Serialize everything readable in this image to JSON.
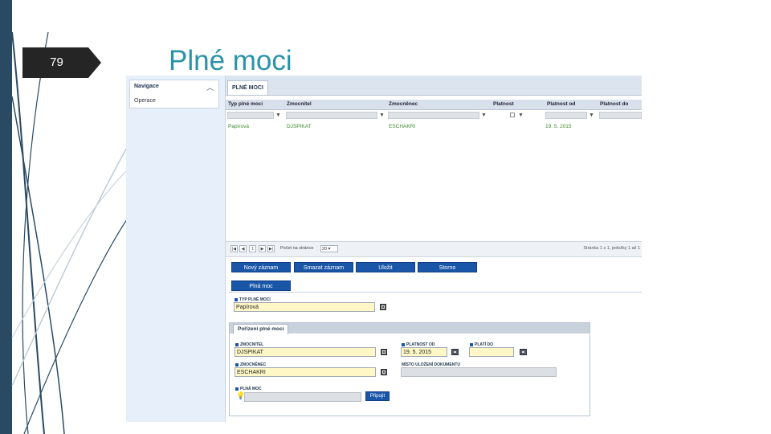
{
  "slide": {
    "number": "79",
    "title": "Plné moci"
  },
  "nav": {
    "header": "Navigace",
    "items": [
      "Operace"
    ]
  },
  "tab": {
    "label": "PLNÉ MOCI"
  },
  "grid": {
    "columns": [
      "Typ plné moci",
      "Zmocnitel",
      "Zmocněnec",
      "Platnost",
      "Platnost od",
      "Platnost do"
    ],
    "rows": [
      [
        "Papírová",
        "DJSPIKAT",
        "ESCHAKRI",
        "",
        "19. 5. 2015",
        ""
      ]
    ]
  },
  "pager": {
    "page": "1",
    "label": "Počet na stránce",
    "page_size": "20",
    "info": "Stránka 1 z 1, položky 1 až 1"
  },
  "actions": {
    "new": "Nový záznam",
    "delete": "Smazat záznam",
    "save": "Uložit",
    "cancel": "Storno"
  },
  "section": {
    "label": "Plná moc"
  },
  "form": {
    "type_label": "TYP PLNÉ MOCI",
    "type_value": "Papírová",
    "panel_tab": "Pořízení plné moci",
    "principal_label": "ZMOCNITEL",
    "principal_value": "DJSPIKAT",
    "agent_label": "ZMOCNĚNEC",
    "agent_value": "ESCHAKRI",
    "valid_from_label": "PLATNOST OD",
    "valid_from_value": "19. 5. 2015",
    "valid_to_label": "PLATÍ DO",
    "valid_to_value": "",
    "storage_label": "MÍSTO ULOŽENÍ DOKUMENTU",
    "document_label": "PLNÁ MOC",
    "attach_button": "Připojit"
  },
  "colors": {
    "accent": "#1a56a8",
    "title": "#2a92a8",
    "row_text": "#3c8a2c",
    "required_bg": "#fff8c6"
  }
}
